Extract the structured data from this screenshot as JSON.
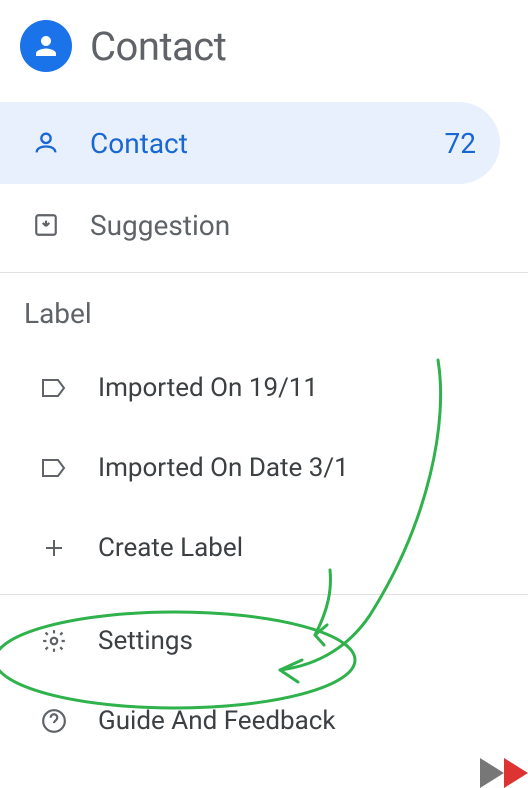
{
  "header": {
    "title": "Contact"
  },
  "nav": {
    "contact": {
      "label": "Contact",
      "count": "72"
    },
    "suggestion": {
      "label": "Suggestion"
    }
  },
  "labels": {
    "section_title": "Label",
    "items": [
      {
        "text": "Imported On 19/11"
      },
      {
        "text": "Imported On Date 3/1"
      }
    ],
    "create": "Create Label"
  },
  "footer": {
    "settings": "Settings",
    "help": "Guide And Feedback"
  },
  "colors": {
    "primary": "#1a73e8",
    "active_bg": "#e8f0fe",
    "text_gray": "#5f6368",
    "annotation": "#2fb24c"
  }
}
